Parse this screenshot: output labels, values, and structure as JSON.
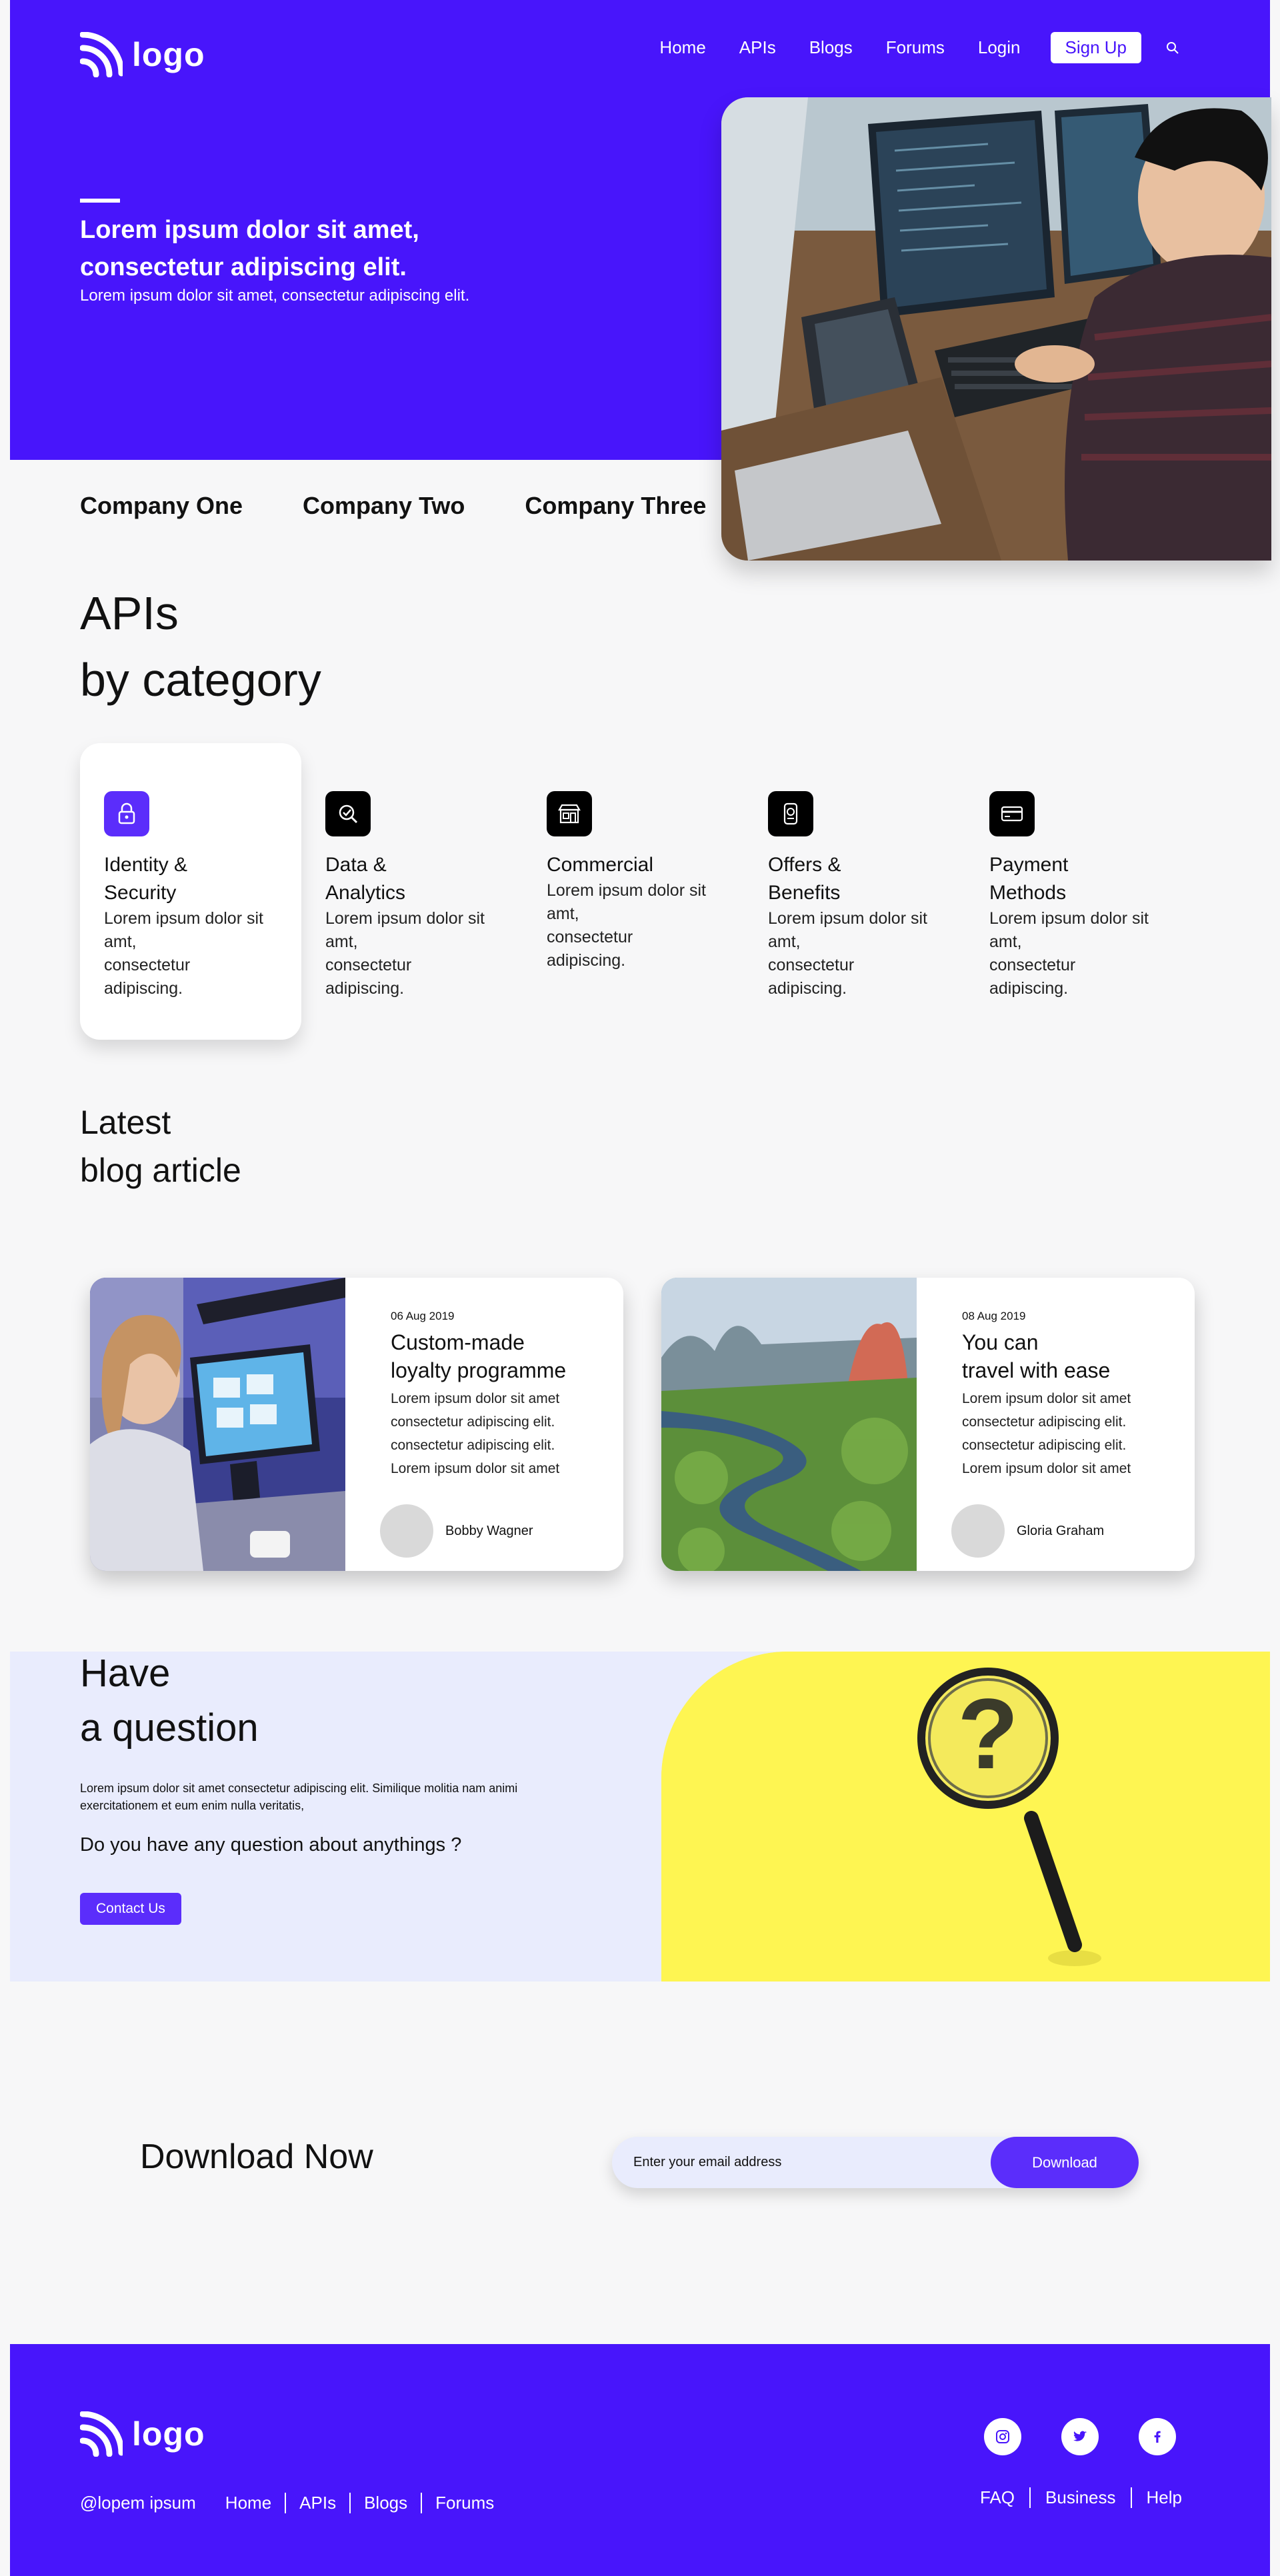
{
  "brand": {
    "logo_text": "logo",
    "primary": "#4815fb",
    "accent": "#5b2dfb",
    "yellow": "#fef552"
  },
  "nav": {
    "items": [
      "Home",
      "APIs",
      "Blogs",
      "Forums",
      "Login"
    ],
    "signup": "Sign Up",
    "search_icon": "search-icon"
  },
  "hero": {
    "heading_line1": "Lorem ipsum dolor sit amet,",
    "heading_line2": "consectetur adipiscing elit.",
    "subtext": "Lorem ipsum dolor sit amet, consectetur adipiscing elit."
  },
  "companies": [
    "Company One",
    "Company Two",
    "Company Three"
  ],
  "apis": {
    "title_line1": "APIs",
    "title_line2": "by category",
    "categories": [
      {
        "title_line1": "Identity &",
        "title_line2": "Security",
        "desc": [
          "Lorem ipsum dolor sit",
          "amt,",
          "consectetur",
          "adipiscing."
        ],
        "icon": "lock-icon"
      },
      {
        "title_line1": "Data &",
        "title_line2": "Analytics",
        "desc": [
          "Lorem ipsum dolor sit",
          "amt,",
          "consectetur",
          "adipiscing."
        ],
        "icon": "analytics-icon"
      },
      {
        "title_line1": "Commercial",
        "title_line2": "",
        "desc": [
          "Lorem ipsum dolor sit",
          "amt,",
          "consectetur",
          "adipiscing."
        ],
        "icon": "store-icon"
      },
      {
        "title_line1": "Offers &",
        "title_line2": "Benefits",
        "desc": [
          "Lorem ipsum dolor sit",
          "amt,",
          "consectetur",
          "adipiscing."
        ],
        "icon": "tag-icon"
      },
      {
        "title_line1": "Payment",
        "title_line2": "Methods",
        "desc": [
          "Lorem ipsum dolor sit",
          "amt,",
          "consectetur",
          "adipiscing."
        ],
        "icon": "card-icon"
      }
    ]
  },
  "blog": {
    "title_line1": "Latest",
    "title_line2": "blog article",
    "articles": [
      {
        "date": "06 Aug 2019",
        "title_line1": "Custom-made",
        "title_line2": "loyalty programme",
        "text": [
          "Lorem ipsum dolor sit amet",
          "consectetur adipiscing elit.",
          "consectetur adipiscing elit.",
          "Lorem ipsum dolor sit amet"
        ],
        "author": "Bobby Wagner"
      },
      {
        "date": "08 Aug 2019",
        "title_line1": "You can",
        "title_line2": "travel with ease",
        "text": [
          "Lorem ipsum dolor sit amet",
          "consectetur adipiscing elit.",
          "consectetur adipiscing elit.",
          "Lorem ipsum dolor sit amet"
        ],
        "author": "Gloria Graham"
      }
    ]
  },
  "question": {
    "title_line1": "Have",
    "title_line2": "a question",
    "text": "Lorem ipsum dolor sit amet consectetur adipiscing elit. Similique molitia nam animi exercitationem et eum enim nulla veritatis,",
    "ask": "Do you have any question about anythings ?",
    "button": "Contact Us"
  },
  "download": {
    "title_bold": "Download",
    "title_rest": "Now",
    "placeholder": "Enter your email address",
    "button": "Download"
  },
  "footer": {
    "copyright": "@lopem ipsum",
    "links": [
      "Home",
      "APIs",
      "Blogs",
      "Forums"
    ],
    "right_links": [
      "FAQ",
      "Business",
      "Help"
    ],
    "socials": [
      "instagram-icon",
      "twitter-icon",
      "facebook-icon"
    ]
  }
}
